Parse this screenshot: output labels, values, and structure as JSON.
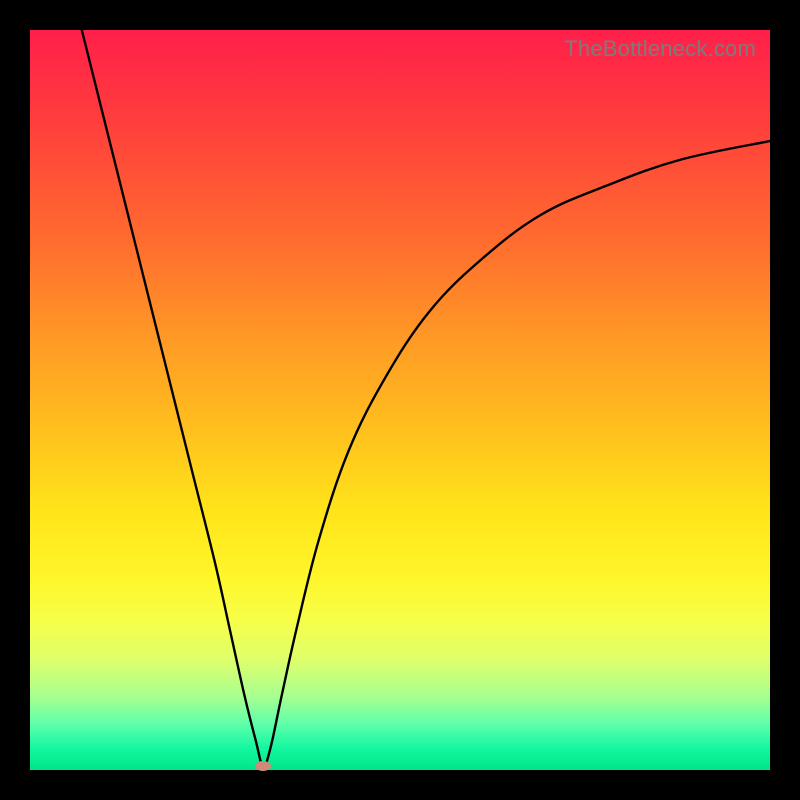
{
  "watermark": "TheBottleneck.com",
  "chart_data": {
    "type": "line",
    "title": "",
    "xlabel": "",
    "ylabel": "",
    "xlim": [
      0,
      100
    ],
    "ylim": [
      0,
      100
    ],
    "grid": false,
    "legend": false,
    "series": [
      {
        "name": "bottleneck-curve",
        "x": [
          7,
          10,
          13,
          16,
          19,
          22,
          25,
          27,
          29,
          30.5,
          31.5,
          32.5,
          34,
          36,
          39,
          43,
          48,
          54,
          61,
          69,
          78,
          88,
          100
        ],
        "y": [
          100,
          88,
          76,
          64,
          52,
          40,
          28,
          19,
          10,
          4,
          0.5,
          3,
          10,
          19,
          31,
          43,
          53,
          62,
          69,
          75,
          79,
          82.5,
          85
        ]
      }
    ],
    "minimum_marker": {
      "x": 31.5,
      "y": 0.5,
      "color": "#cf8a7a"
    },
    "background_gradient": {
      "orientation": "vertical",
      "stops": [
        {
          "pos": 0.0,
          "color": "#ff1f4a"
        },
        {
          "pos": 0.28,
          "color": "#ff6a2f"
        },
        {
          "pos": 0.55,
          "color": "#ffc31d"
        },
        {
          "pos": 0.74,
          "color": "#fff62a"
        },
        {
          "pos": 0.9,
          "color": "#a8ff8f"
        },
        {
          "pos": 1.0,
          "color": "#00e58a"
        }
      ]
    }
  }
}
